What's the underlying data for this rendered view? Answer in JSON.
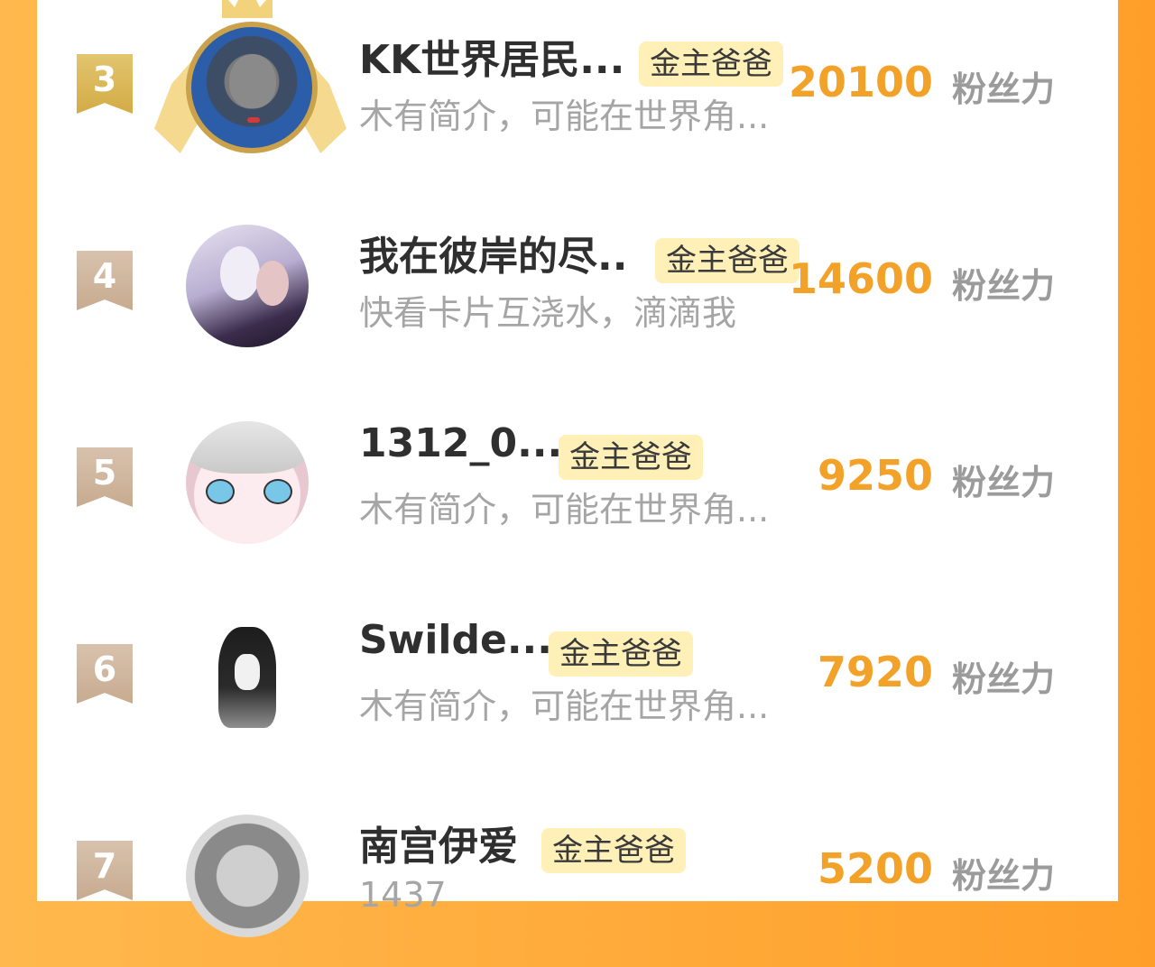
{
  "unit_label": "粉丝力",
  "badge_label": "金主爸爸",
  "rows": [
    {
      "rank": "3",
      "name": "KK世界居民...",
      "bio": "木有简介，可能在世界角...",
      "score": "20100",
      "avatar": "cat-photo-avatar",
      "top_rank_frame": true
    },
    {
      "rank": "4",
      "name": "我在彼岸的尽..",
      "bio": "快看卡片互浇水，滴滴我",
      "score": "14600",
      "avatar": "embrace-illustration-avatar"
    },
    {
      "rank": "5",
      "name": "1312_0...",
      "bio": "木有简介，可能在世界角...",
      "score": "9250",
      "avatar": "anime-face-avatar"
    },
    {
      "rank": "6",
      "name": "Swilde...",
      "bio": "木有简介，可能在世界角...",
      "score": "7920",
      "avatar": "demon-sketch-avatar"
    },
    {
      "rank": "7",
      "name": "南宫伊爱",
      "bio": "1437",
      "score": "5200",
      "avatar": "grayscale-photo-avatar"
    }
  ],
  "colors": {
    "background_gradient": [
      "#ffb84d",
      "#ff9f2a"
    ],
    "score": "#f2a228",
    "badge_bg": "#fff0b8",
    "rank_gold": "#d3ab46",
    "rank_bronze": "#c7ab90"
  }
}
